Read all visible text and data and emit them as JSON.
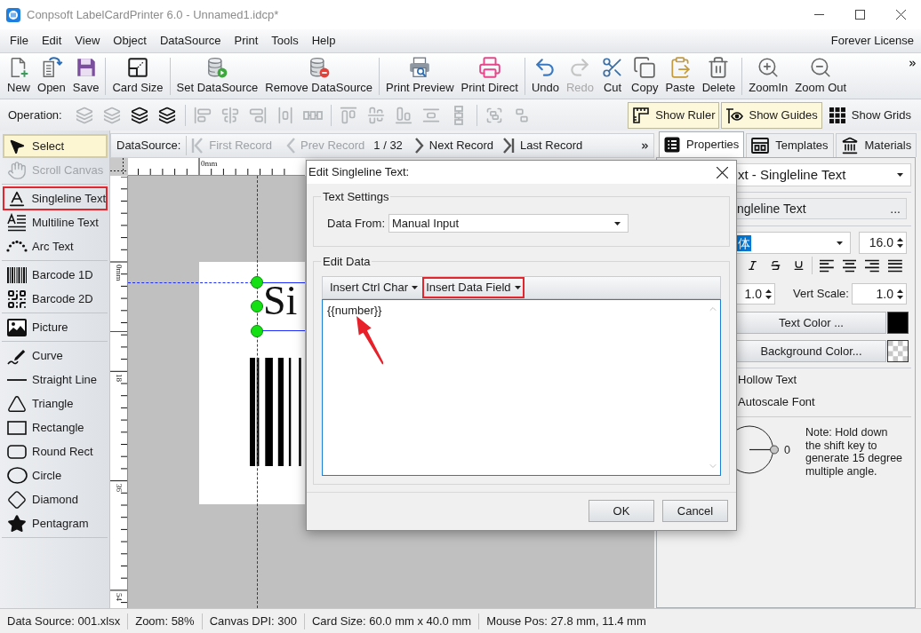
{
  "window": {
    "title": "Conpsoft LabelCardPrinter 6.0 - Unnamed1.idcp*"
  },
  "menu": {
    "items": [
      "File",
      "Edit",
      "View",
      "Object",
      "DataSource",
      "Print",
      "Tools",
      "Help"
    ],
    "license": "Forever License"
  },
  "toolbar": {
    "groups": [
      [
        {
          "label": "New",
          "disabled": false
        },
        {
          "label": "Open",
          "disabled": false
        },
        {
          "label": "Save",
          "disabled": false
        }
      ],
      [
        {
          "label": "Card Size",
          "disabled": false
        }
      ],
      [
        {
          "label": "Set DataSource",
          "disabled": false
        },
        {
          "label": "Remove DataSource",
          "disabled": false
        }
      ],
      [
        {
          "label": "Print Preview",
          "disabled": false
        },
        {
          "label": "Print Direct",
          "disabled": false
        }
      ],
      [
        {
          "label": "Undo",
          "disabled": false
        },
        {
          "label": "Redo",
          "disabled": true
        },
        {
          "label": "Cut",
          "disabled": false
        },
        {
          "label": "Copy",
          "disabled": false
        },
        {
          "label": "Paste",
          "disabled": false
        },
        {
          "label": "Delete",
          "disabled": false
        }
      ],
      [
        {
          "label": "ZoomIn",
          "disabled": false
        },
        {
          "label": "Zoom Out",
          "disabled": false
        }
      ]
    ]
  },
  "operation_bar": {
    "label": "Operation:",
    "icon_groups": [
      [
        {
          "disabled": true
        },
        {
          "disabled": true
        },
        {
          "disabled": false
        },
        {
          "disabled": false
        }
      ],
      [
        {
          "disabled": true
        },
        {
          "disabled": true
        },
        {
          "disabled": true
        },
        {
          "disabled": true
        },
        {
          "disabled": true
        }
      ],
      [
        {
          "disabled": true
        },
        {
          "disabled": true
        },
        {
          "disabled": true
        },
        {
          "disabled": true
        },
        {
          "disabled": true
        }
      ],
      [
        {
          "disabled": true
        },
        {
          "disabled": true
        }
      ]
    ],
    "toggles": [
      {
        "label": "Show Ruler",
        "on": true
      },
      {
        "label": "Show Guides",
        "on": true
      },
      {
        "label": "Show Grids",
        "on": false
      }
    ]
  },
  "tools": {
    "groups": [
      [
        {
          "label": "Select",
          "selected": true,
          "disabled": false,
          "highlighted": false
        },
        {
          "label": "Scroll Canvas",
          "selected": false,
          "disabled": true,
          "highlighted": false
        }
      ],
      [
        {
          "label": "Singleline Text",
          "selected": false,
          "disabled": false,
          "highlighted": true
        },
        {
          "label": "Multiline Text",
          "selected": false,
          "disabled": false,
          "highlighted": false
        },
        {
          "label": "Arc Text",
          "selected": false,
          "disabled": false,
          "highlighted": false
        }
      ],
      [
        {
          "label": "Barcode 1D",
          "selected": false,
          "disabled": false,
          "highlighted": false
        },
        {
          "label": "Barcode 2D",
          "selected": false,
          "disabled": false,
          "highlighted": false
        }
      ],
      [
        {
          "label": "Picture",
          "selected": false,
          "disabled": false,
          "highlighted": false
        }
      ],
      [
        {
          "label": "Curve",
          "selected": false,
          "disabled": false,
          "highlighted": false
        },
        {
          "label": "Straight Line",
          "selected": false,
          "disabled": false,
          "highlighted": false
        },
        {
          "label": "Triangle",
          "selected": false,
          "disabled": false,
          "highlighted": false
        },
        {
          "label": "Rectangle",
          "selected": false,
          "disabled": false,
          "highlighted": false
        },
        {
          "label": "Round Rect",
          "selected": false,
          "disabled": false,
          "highlighted": false
        },
        {
          "label": "Circle",
          "selected": false,
          "disabled": false,
          "highlighted": false
        },
        {
          "label": "Diamond",
          "selected": false,
          "disabled": false,
          "highlighted": false
        },
        {
          "label": "Pentagram",
          "selected": false,
          "disabled": false,
          "highlighted": false
        }
      ]
    ]
  },
  "record_nav": {
    "label": "DataSource:",
    "items": [
      {
        "kind": "first",
        "label": "First Record",
        "disabled": true
      },
      {
        "kind": "prev",
        "label": "Prev Record",
        "disabled": true
      },
      {
        "kind": "position",
        "label": "1 / 32"
      },
      {
        "kind": "next",
        "label": "Next Record",
        "disabled": false
      },
      {
        "kind": "last",
        "label": "Last Record",
        "disabled": false
      }
    ]
  },
  "rulers": {
    "top_labels": [
      "0mm"
    ],
    "left_labels": [
      "0mm",
      "18",
      "36",
      "54"
    ]
  },
  "canvas": {
    "text": "Si"
  },
  "dialog": {
    "title": "Edit Singleline Text:",
    "text_settings": {
      "legend": "Text Settings",
      "label": "Data From:",
      "value": "Manual Input"
    },
    "edit_data": {
      "legend": "Edit Data",
      "tools": [
        {
          "label": "Insert Ctrl Char",
          "highlighted": false
        },
        {
          "label": "Insert Data Field",
          "highlighted": true
        }
      ],
      "value": "{{number}}"
    },
    "buttons": [
      "OK",
      "Cancel"
    ]
  },
  "properties_panel": {
    "tabs": [
      {
        "label": "Properties",
        "selected": true
      },
      {
        "label": "Templates",
        "selected": false
      },
      {
        "label": "Materials",
        "selected": false
      }
    ],
    "object_type": "xt - Singleline Text",
    "object_name": "ngleline Text",
    "name_button": "...",
    "font_name": "体",
    "font_size": "16.0",
    "horz_scale": "1.0",
    "vert_scale_label": "Vert Scale:",
    "vert_scale": "1.0",
    "color_buttons": [
      {
        "label": "Text Color ...",
        "kind": "solid",
        "color": "#000000"
      },
      {
        "label": "Background Color...",
        "kind": "transparent"
      }
    ],
    "options": [
      "Hollow Text",
      "Autoscale Font"
    ],
    "angle": "0",
    "note": "Note: Hold down the shift key to generate 15 degree multiple angle."
  },
  "status_bar": [
    "Data Source: 001.xlsx",
    "Zoom: 58%",
    "Canvas DPI: 300",
    "Card Size: 60.0 mm x 40.0 mm",
    "Mouse Pos: 27.8 mm, 11.4 mm"
  ]
}
